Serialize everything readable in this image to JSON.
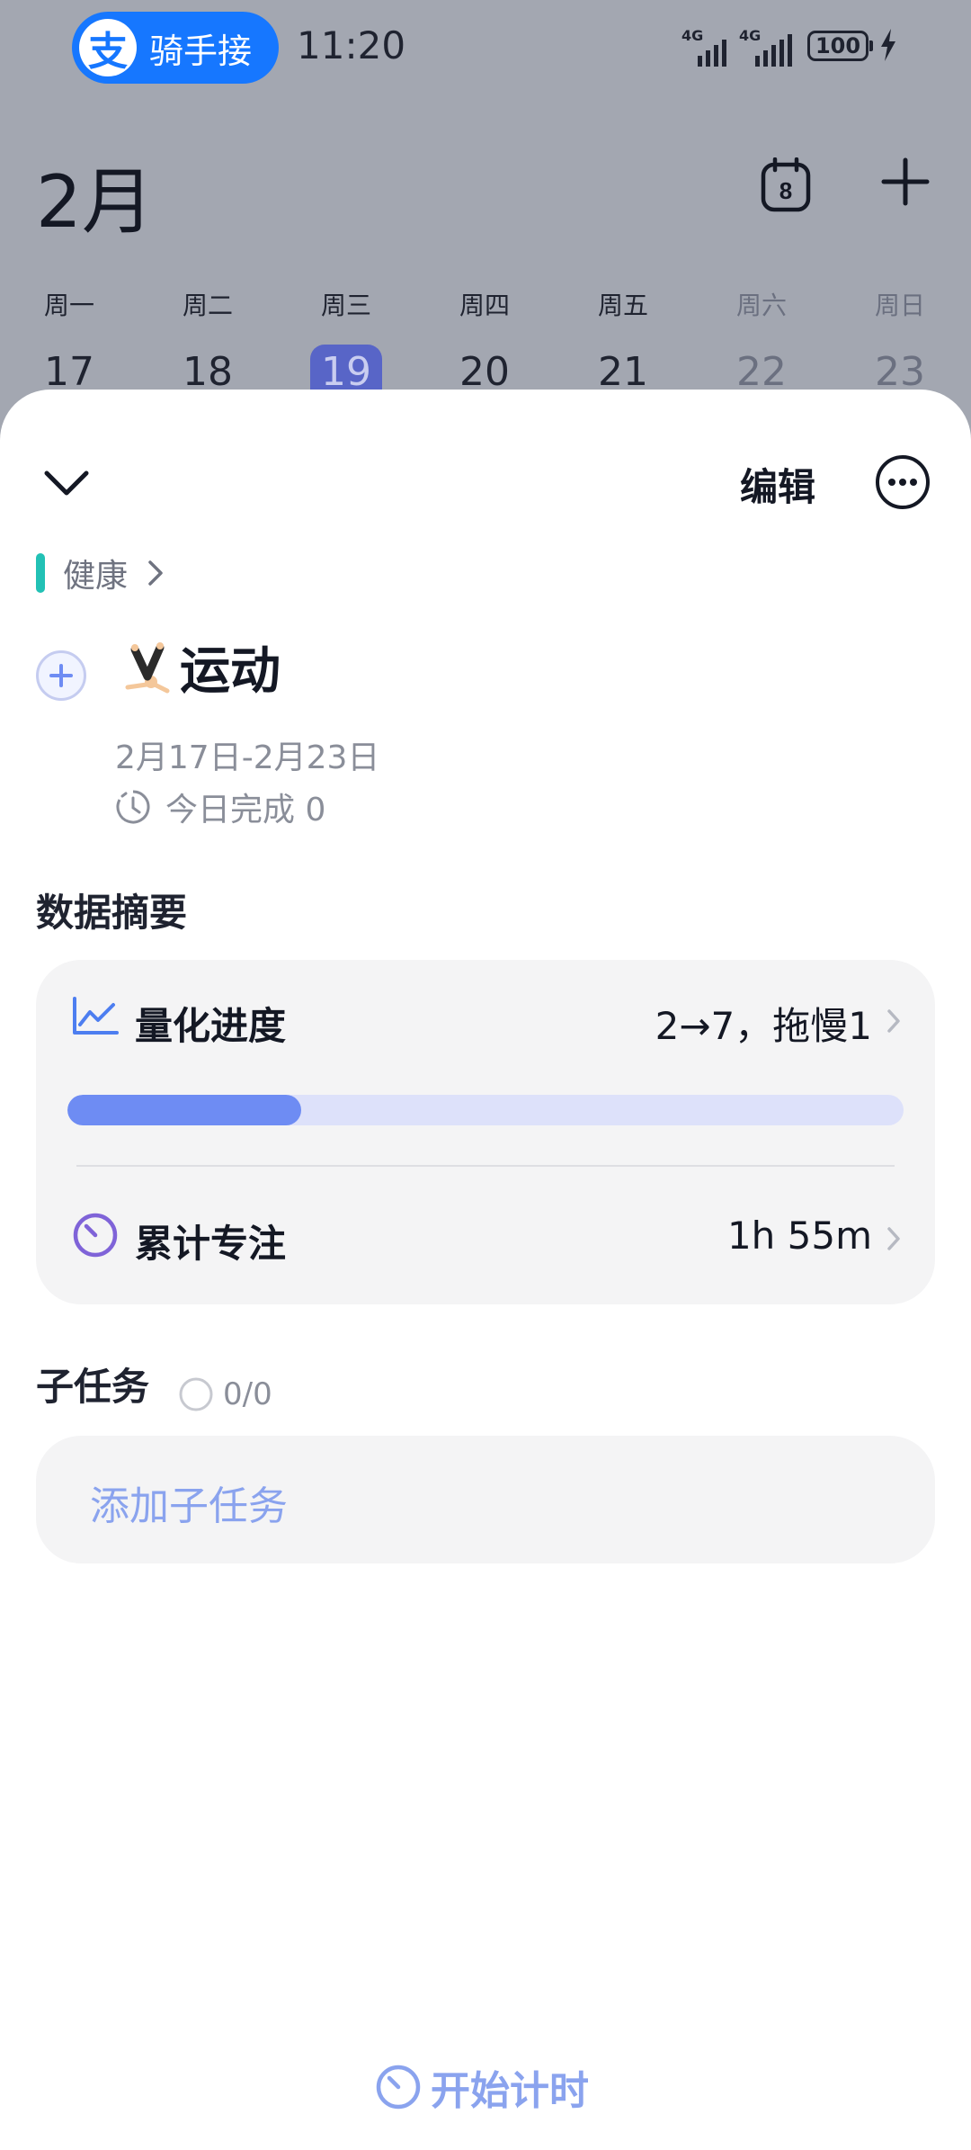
{
  "status_bar": {
    "app_pill_text": "骑手接",
    "time": "11:20",
    "signal1_tag": "4G",
    "signal2_tag": "4G",
    "battery": "100"
  },
  "calendar": {
    "month": "2月",
    "calendar_day": "8",
    "weekdays": [
      "周一",
      "周二",
      "周三",
      "周四",
      "周五",
      "周六",
      "周日"
    ],
    "dates": [
      "17",
      "18",
      "19",
      "20",
      "21",
      "22",
      "23"
    ],
    "selected_date": "19"
  },
  "sheet": {
    "edit_label": "编辑",
    "category": "健康",
    "task_title": "运动",
    "date_range": "2月17日-2月23日",
    "today_done": "今日完成 0",
    "summary_title": "数据摘要",
    "quant": {
      "label": "量化进度",
      "value": "2→7，拖慢1",
      "progress_fraction": 0.28
    },
    "focus": {
      "label": "累计专注",
      "value": "1h 55m"
    },
    "subtasks_title": "子任务",
    "subtasks_count": "0/0",
    "add_subtask": "添加子任务",
    "start_timer": "开始计时"
  },
  "colors": {
    "accent": "#6e8cf3",
    "category": "#22c1b5",
    "today": "#5865c7",
    "focus_icon": "#7f63d8"
  },
  "icons": [
    "alipay-icon",
    "signal-icon",
    "battery-icon",
    "charging-icon",
    "calendar-icon",
    "add-icon",
    "chevron-down-icon",
    "more-icon",
    "chevron-right-icon",
    "plus-icon",
    "exercise-emoji-icon",
    "clock-dashed-icon",
    "chart-line-icon",
    "timer-icon",
    "radio-empty-icon"
  ]
}
